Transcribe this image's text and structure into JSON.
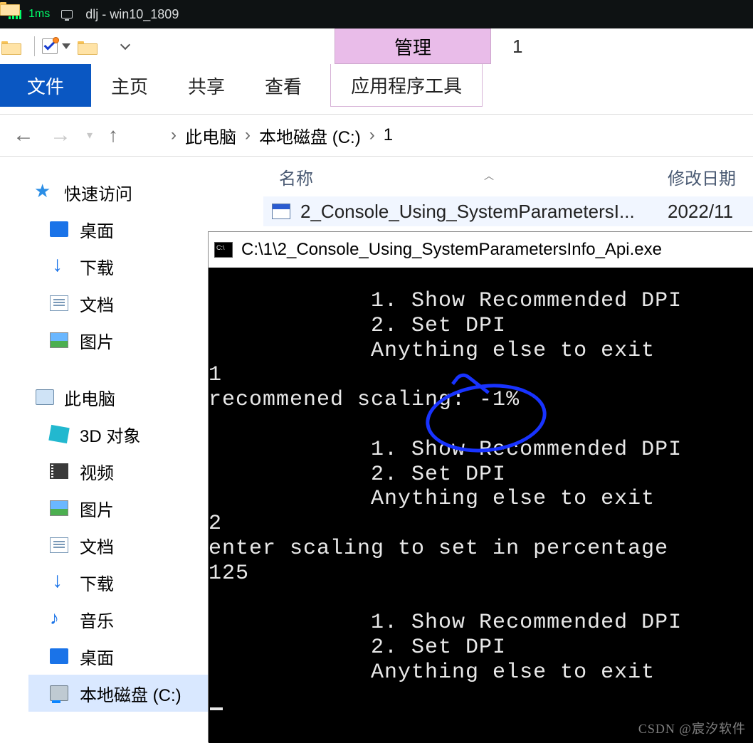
{
  "remote": {
    "latency": "1ms",
    "title": "dlj - win10_1809"
  },
  "ribbon": {
    "context_group": "管理",
    "window_title": "1",
    "tabs": {
      "file": "文件",
      "home": "主页",
      "share": "共享",
      "view": "查看",
      "context": "应用程序工具"
    }
  },
  "breadcrumbs": {
    "items": [
      "此电脑",
      "本地磁盘 (C:)",
      "1"
    ]
  },
  "columns": {
    "name": "名称",
    "date": "修改日期"
  },
  "sidebar": {
    "quick": "快速访问",
    "quick_items": [
      {
        "icon": "desktop",
        "label": "桌面"
      },
      {
        "icon": "dl",
        "label": "下载"
      },
      {
        "icon": "doc",
        "label": "文档"
      },
      {
        "icon": "pic",
        "label": "图片"
      }
    ],
    "pc": "此电脑",
    "pc_items": [
      {
        "icon": "cube",
        "label": "3D 对象"
      },
      {
        "icon": "vid",
        "label": "视频"
      },
      {
        "icon": "pic",
        "label": "图片"
      },
      {
        "icon": "doc",
        "label": "文档"
      },
      {
        "icon": "dl",
        "label": "下载"
      },
      {
        "icon": "music",
        "label": "音乐"
      },
      {
        "icon": "desktop",
        "label": "桌面"
      },
      {
        "icon": "drive",
        "label": "本地磁盘 (C:)",
        "selected": true
      }
    ]
  },
  "files": [
    {
      "name": "2_Console_Using_SystemParametersI...",
      "date": "2022/11"
    }
  ],
  "console": {
    "title": "C:\\1\\2_Console_Using_SystemParametersInfo_Api.exe",
    "lines": [
      "            1. Show Recommended DPI",
      "            2. Set DPI",
      "            Anything else to exit",
      "1",
      "recommened scaling: -1%",
      "",
      "            1. Show Recommended DPI",
      "            2. Set DPI",
      "            Anything else to exit",
      "2",
      "enter scaling to set in percentage",
      "125",
      "",
      "            1. Show Recommended DPI",
      "            2. Set DPI",
      "            Anything else to exit"
    ]
  },
  "watermark": "CSDN @宸汐软件"
}
